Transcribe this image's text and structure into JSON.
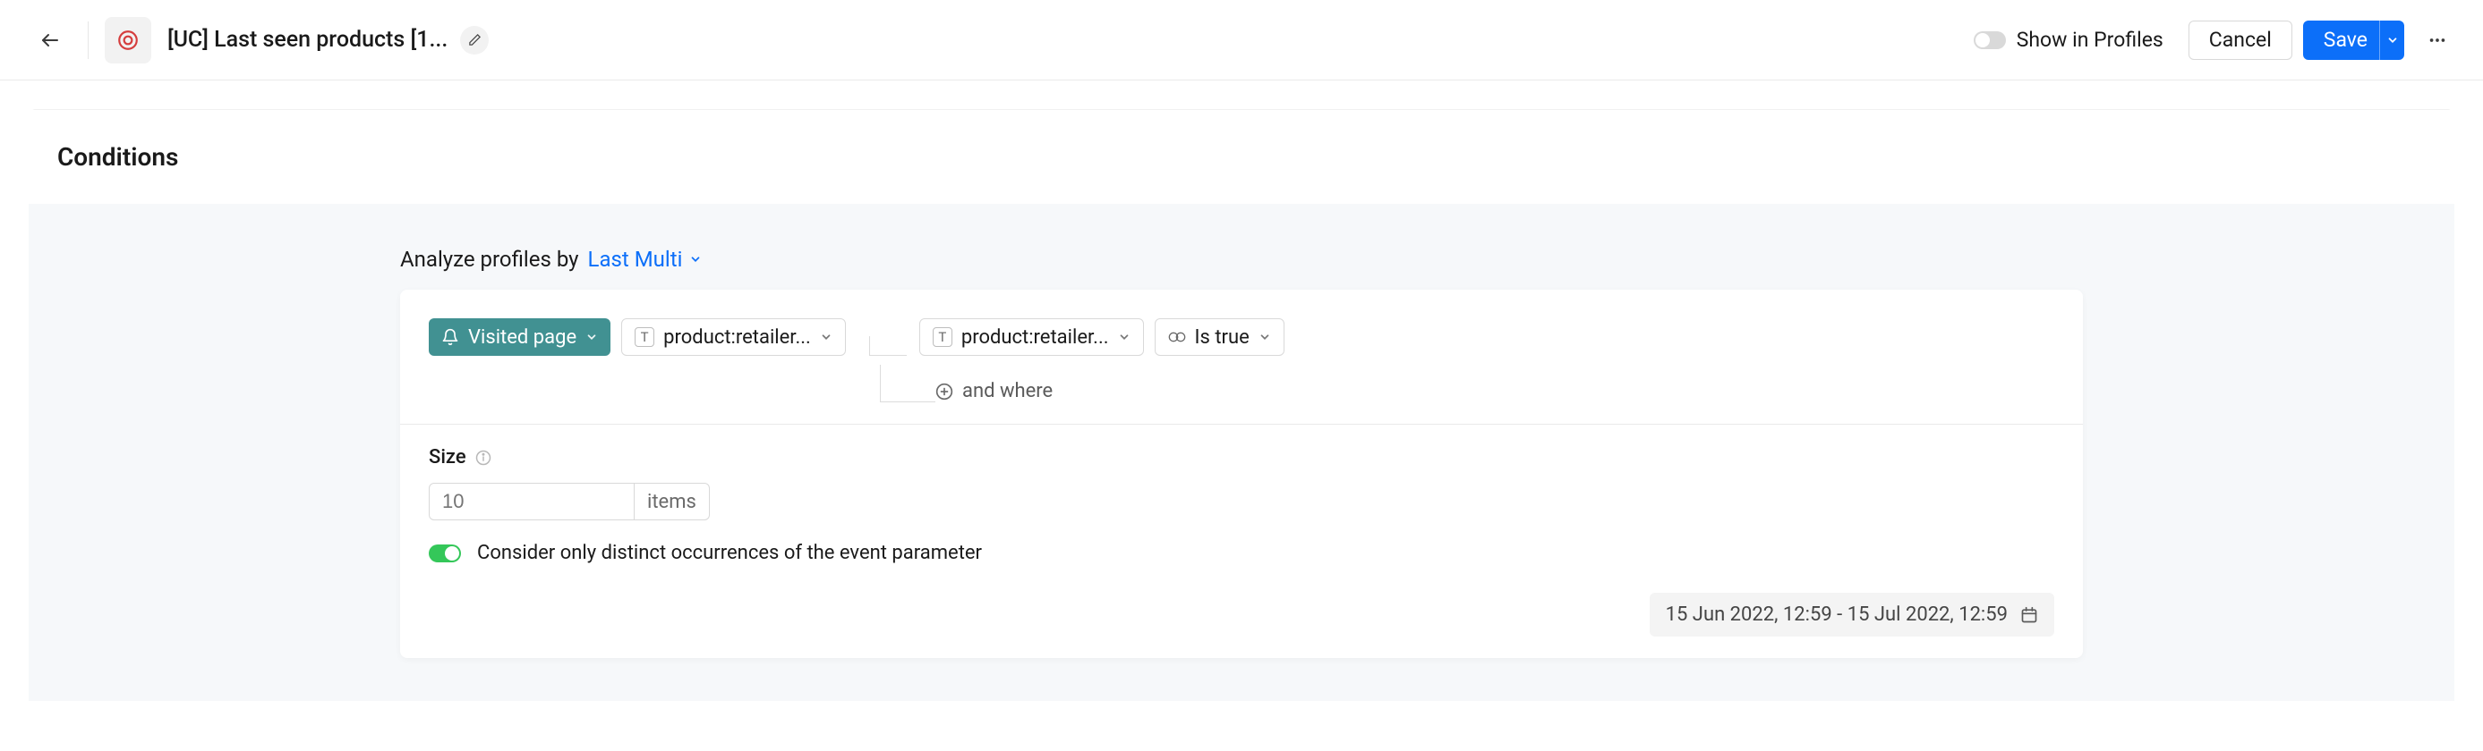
{
  "header": {
    "title": "[UC] Last seen products [1...",
    "show_in_profiles_label": "Show in Profiles",
    "cancel_label": "Cancel",
    "save_label": "Save"
  },
  "conditions": {
    "title": "Conditions",
    "analyze_prefix": "Analyze profiles by",
    "analyze_value": "Last Multi",
    "event_chip": "Visited page",
    "param1": "product:retailer...",
    "param2": "product:retailer...",
    "operator": "Is true",
    "and_where": "and where",
    "size_label": "Size",
    "size_placeholder": "10",
    "size_unit": "items",
    "distinct_label": "Consider only distinct occurrences of the event parameter",
    "date_range": "15 Jun 2022, 12:59 - 15 Jul 2022, 12:59"
  },
  "toggles": {
    "show_in_profiles": false,
    "distinct": true
  }
}
